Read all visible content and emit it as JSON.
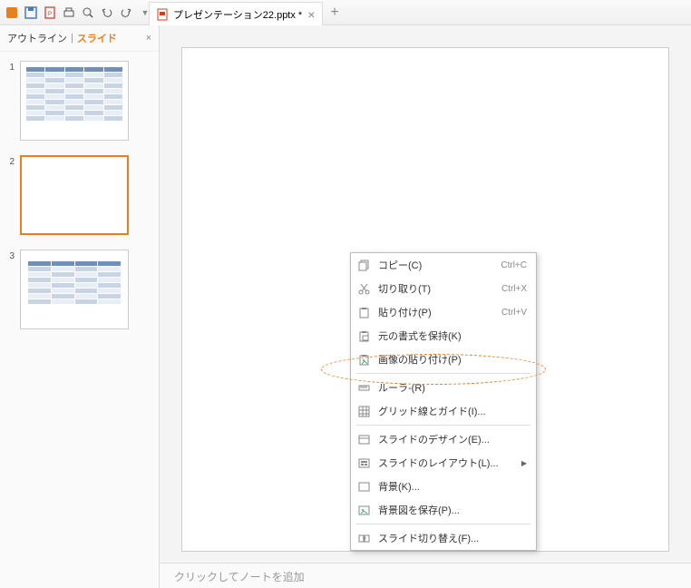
{
  "toolbar": {
    "icons": [
      "app-icon",
      "save-icon",
      "pdf-icon",
      "print-icon",
      "preview-icon",
      "undo-icon",
      "redo-icon",
      "more-icon"
    ]
  },
  "file_tab": {
    "name": "プレゼンテーション22.pptx *"
  },
  "sidebar": {
    "tabs": {
      "outline": "アウトライン",
      "divider": "|",
      "slide": "スライド"
    },
    "thumbs": [
      {
        "num": "1",
        "type": "table"
      },
      {
        "num": "2",
        "type": "blank"
      },
      {
        "num": "3",
        "type": "table"
      }
    ]
  },
  "notes": "クリックしてノートを追加",
  "context_menu": {
    "items": [
      {
        "icon": "copy",
        "label": "コピー(C)",
        "shortcut": "Ctrl+C"
      },
      {
        "icon": "cut",
        "label": "切り取り(T)",
        "shortcut": "Ctrl+X"
      },
      {
        "icon": "paste",
        "label": "貼り付け(P)",
        "shortcut": "Ctrl+V"
      },
      {
        "icon": "paste-format",
        "label": "元の書式を保持(K)",
        "shortcut": ""
      },
      {
        "icon": "paste-image",
        "label": "画像の貼り付け(P)",
        "shortcut": ""
      },
      {
        "sep": true
      },
      {
        "icon": "ruler",
        "label": "ルーラ-(R)",
        "shortcut": ""
      },
      {
        "icon": "grid",
        "label": "グリッド線とガイド(I)...",
        "shortcut": ""
      },
      {
        "sep": true
      },
      {
        "icon": "design",
        "label": "スライドのデザイン(E)...",
        "shortcut": ""
      },
      {
        "icon": "layout",
        "label": "スライドのレイアウト(L)...",
        "shortcut": "",
        "arrow": true
      },
      {
        "icon": "background",
        "label": "背景(K)...",
        "shortcut": ""
      },
      {
        "icon": "save-bg",
        "label": "背景図を保存(P)...",
        "shortcut": ""
      },
      {
        "sep": true
      },
      {
        "icon": "transition",
        "label": "スライド切り替え(F)...",
        "shortcut": ""
      }
    ]
  }
}
